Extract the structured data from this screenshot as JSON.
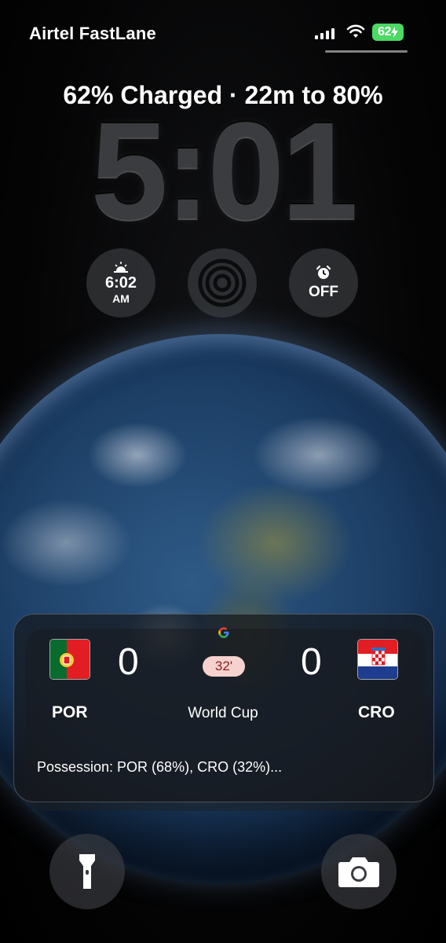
{
  "status_bar": {
    "carrier": "Airtel FastLane",
    "battery_percent": "62",
    "signal_icon": "cellular-signal-icon",
    "wifi_icon": "wifi-icon",
    "battery_color": "#4cd964"
  },
  "lock_screen": {
    "charging_status": "62% Charged · 22m to 80%",
    "time": "5:01"
  },
  "widgets": {
    "sunrise": {
      "icon": "sunrise-icon",
      "time": "6:02",
      "period": "AM"
    },
    "focus": {
      "icon": "focus-rings-icon"
    },
    "alarm": {
      "icon": "alarm-clock-icon",
      "status": "OFF"
    }
  },
  "live_activity": {
    "provider_icon": "google-logo-icon",
    "home_team": {
      "code": "POR",
      "score": "0",
      "flag": "portugal-flag-icon"
    },
    "away_team": {
      "code": "CRO",
      "score": "0",
      "flag": "croatia-flag-icon"
    },
    "match_minute": "32'",
    "competition": "World Cup",
    "summary": "Possession: POR (68%), CRO (32%)...",
    "minute_badge_bg": "#f6d2cf",
    "minute_badge_text": "#8b1f1a"
  },
  "quick_actions": {
    "flashlight_icon": "flashlight-icon",
    "camera_icon": "camera-icon"
  }
}
